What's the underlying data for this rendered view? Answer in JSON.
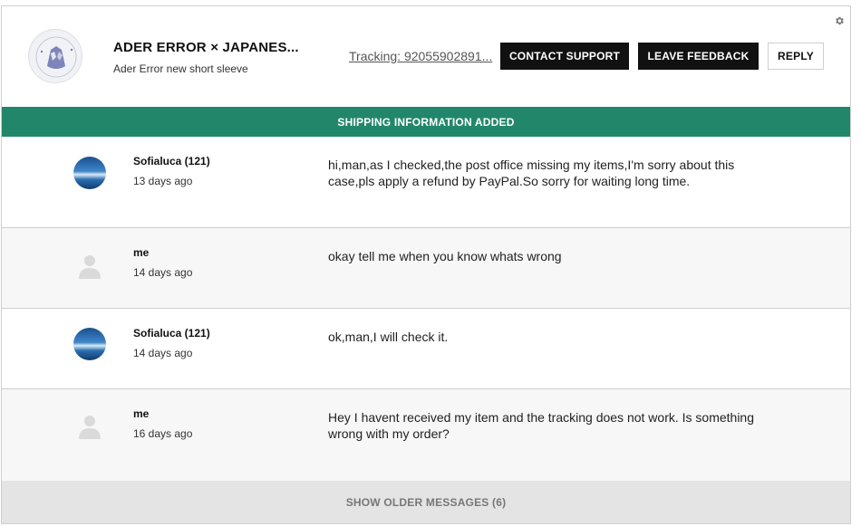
{
  "header": {
    "item_title": "ADER ERROR × JAPANES...",
    "item_subtitle": "Ader Error new short sleeve",
    "tracking_link": "Tracking: 92055902891...",
    "contact_support_label": "CONTACT SUPPORT",
    "leave_feedback_label": "LEAVE FEEDBACK",
    "reply_label": "REPLY",
    "settings_icon": "gear-icon"
  },
  "status": {
    "label": "SHIPPING INFORMATION ADDED",
    "color": "#22876a"
  },
  "messages": [
    {
      "sender": "Sofialuca (121)",
      "time": "13 days ago",
      "text": "hi,man,as I checked,the post office missing my items,I'm sorry about this case,pls apply a refund by PayPal.So sorry for waiting long time.",
      "avatar": "photo"
    },
    {
      "sender": "me",
      "time": "14 days ago",
      "text": "okay tell me when you know whats wrong",
      "avatar": "default-user-icon"
    },
    {
      "sender": "Sofialuca (121)",
      "time": "14 days ago",
      "text": "ok,man,I will check it.",
      "avatar": "photo"
    },
    {
      "sender": "me",
      "time": "16 days ago",
      "text": "Hey I havent received my item and the tracking does not work. Is something wrong with my order?",
      "avatar": "default-user-icon"
    }
  ],
  "footer": {
    "show_older_label": "SHOW OLDER MESSAGES (6)"
  }
}
